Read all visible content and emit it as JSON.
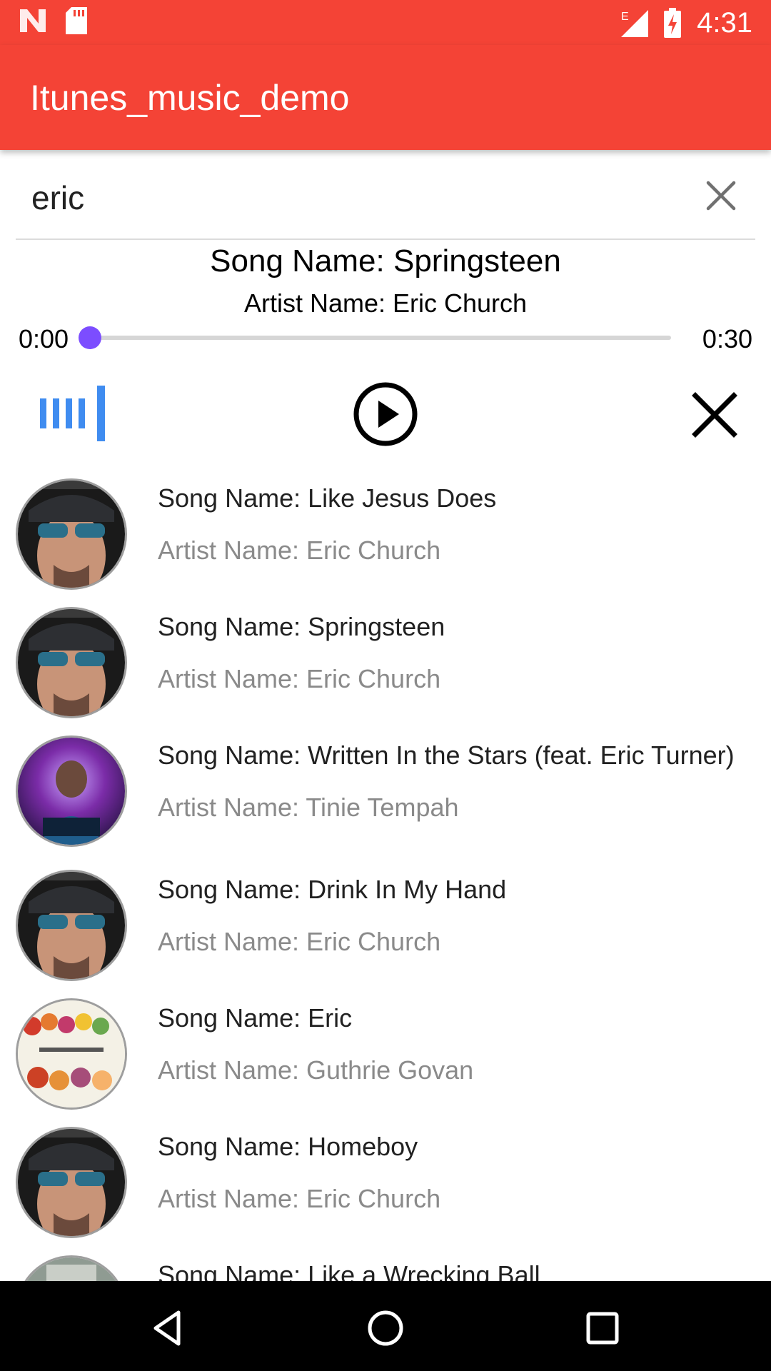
{
  "status_bar": {
    "time": "4:31",
    "network_label": "E",
    "icons": [
      "n-app-icon",
      "sd-card-icon",
      "signal-icon",
      "battery-charging-icon"
    ]
  },
  "app_bar": {
    "title": "Itunes_music_demo"
  },
  "search": {
    "value": "eric",
    "clear_icon": "close-icon"
  },
  "now_playing": {
    "song": "Song Name: Springsteen",
    "artist": "Artist Name: Eric Church",
    "elapsed": "0:00",
    "duration": "0:30",
    "progress": 0.0,
    "accent_color": "#7c4dff",
    "controls": [
      "equalizer-icon",
      "play-icon",
      "close-icon"
    ]
  },
  "results": [
    {
      "song": "Song Name: Like Jesus Does",
      "artist": "Artist Name: Eric Church",
      "artwork": "eric-church-cover"
    },
    {
      "song": "Song Name: Springsteen",
      "artist": "Artist Name: Eric Church",
      "artwork": "eric-church-cover"
    },
    {
      "song": "Song Name: Written In the Stars (feat. Eric Turner)",
      "artist": "Artist Name: Tinie Tempah",
      "artwork": "tinie-tempah-cover"
    },
    {
      "song": "Song Name: Drink In My Hand",
      "artist": "Artist Name: Eric Church",
      "artwork": "eric-church-cover"
    },
    {
      "song": "Song Name: Eric",
      "artist": "Artist Name: Guthrie Govan",
      "artwork": "erotic-cakes-cover"
    },
    {
      "song": "Song Name: Homeboy",
      "artist": "Artist Name: Eric Church",
      "artwork": "eric-church-cover"
    },
    {
      "song": "Song Name: Like a Wrecking Ball",
      "artist": "",
      "artwork": "album-cover"
    }
  ],
  "colors": {
    "app_bar": "#f44336",
    "nav_bar": "#000000",
    "equalizer": "#3f8cf0"
  },
  "nav_bar": [
    "back-icon",
    "home-icon",
    "recents-icon"
  ]
}
